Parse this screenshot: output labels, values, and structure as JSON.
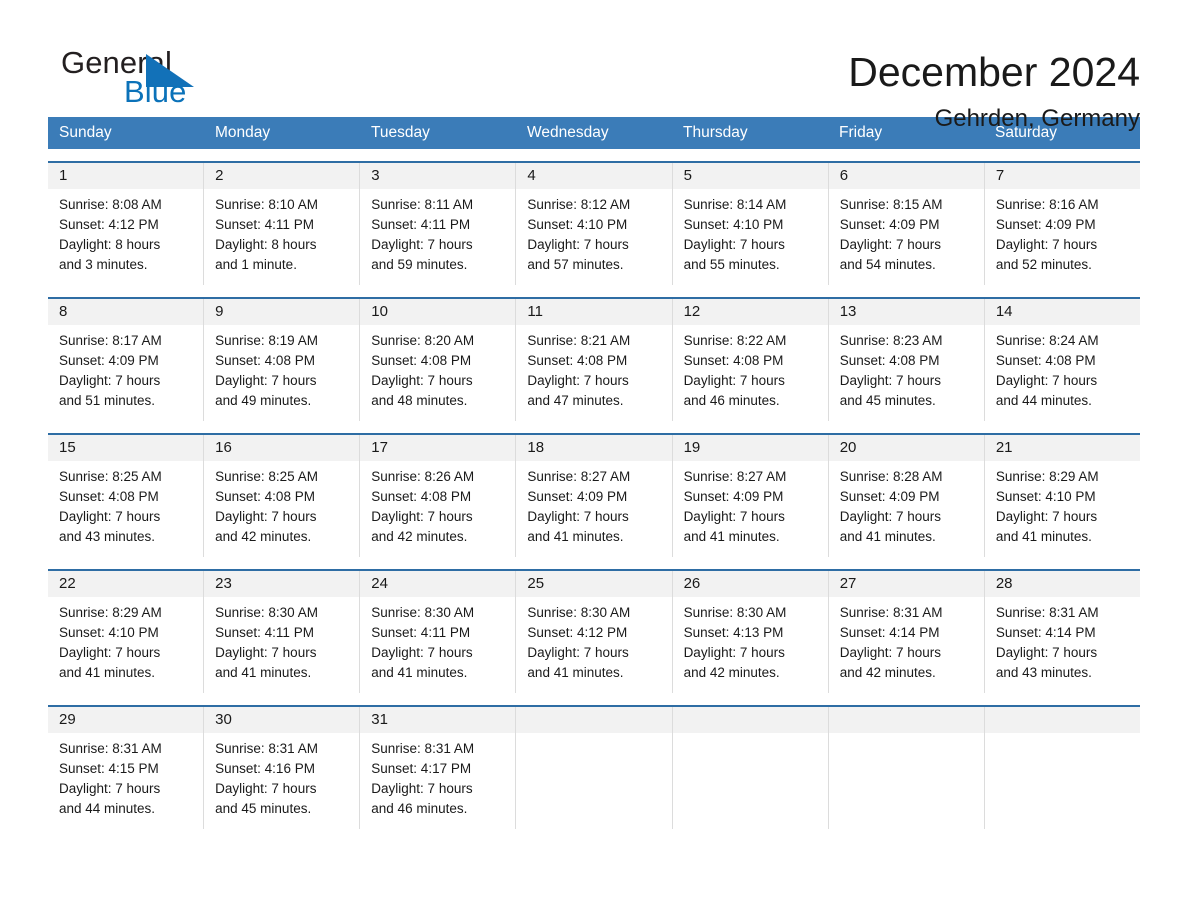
{
  "brand": {
    "name_part1": "General",
    "name_part2": "Blue",
    "logo_icon": "triangle-logo-icon"
  },
  "header": {
    "title": "December 2024",
    "subtitle": "Gehrden, Germany"
  },
  "colors": {
    "header_blue": "#3b7cb8",
    "row_rule_blue": "#2e6da4",
    "brand_blue": "#0b72b9",
    "day_number_bg": "#f2f2f2"
  },
  "weekdays": [
    "Sunday",
    "Monday",
    "Tuesday",
    "Wednesday",
    "Thursday",
    "Friday",
    "Saturday"
  ],
  "weeks": [
    [
      {
        "day": "1",
        "sunrise": "Sunrise: 8:08 AM",
        "sunset": "Sunset: 4:12 PM",
        "daylight_line1": "Daylight: 8 hours",
        "daylight_line2": "and 3 minutes."
      },
      {
        "day": "2",
        "sunrise": "Sunrise: 8:10 AM",
        "sunset": "Sunset: 4:11 PM",
        "daylight_line1": "Daylight: 8 hours",
        "daylight_line2": "and 1 minute."
      },
      {
        "day": "3",
        "sunrise": "Sunrise: 8:11 AM",
        "sunset": "Sunset: 4:11 PM",
        "daylight_line1": "Daylight: 7 hours",
        "daylight_line2": "and 59 minutes."
      },
      {
        "day": "4",
        "sunrise": "Sunrise: 8:12 AM",
        "sunset": "Sunset: 4:10 PM",
        "daylight_line1": "Daylight: 7 hours",
        "daylight_line2": "and 57 minutes."
      },
      {
        "day": "5",
        "sunrise": "Sunrise: 8:14 AM",
        "sunset": "Sunset: 4:10 PM",
        "daylight_line1": "Daylight: 7 hours",
        "daylight_line2": "and 55 minutes."
      },
      {
        "day": "6",
        "sunrise": "Sunrise: 8:15 AM",
        "sunset": "Sunset: 4:09 PM",
        "daylight_line1": "Daylight: 7 hours",
        "daylight_line2": "and 54 minutes."
      },
      {
        "day": "7",
        "sunrise": "Sunrise: 8:16 AM",
        "sunset": "Sunset: 4:09 PM",
        "daylight_line1": "Daylight: 7 hours",
        "daylight_line2": "and 52 minutes."
      }
    ],
    [
      {
        "day": "8",
        "sunrise": "Sunrise: 8:17 AM",
        "sunset": "Sunset: 4:09 PM",
        "daylight_line1": "Daylight: 7 hours",
        "daylight_line2": "and 51 minutes."
      },
      {
        "day": "9",
        "sunrise": "Sunrise: 8:19 AM",
        "sunset": "Sunset: 4:08 PM",
        "daylight_line1": "Daylight: 7 hours",
        "daylight_line2": "and 49 minutes."
      },
      {
        "day": "10",
        "sunrise": "Sunrise: 8:20 AM",
        "sunset": "Sunset: 4:08 PM",
        "daylight_line1": "Daylight: 7 hours",
        "daylight_line2": "and 48 minutes."
      },
      {
        "day": "11",
        "sunrise": "Sunrise: 8:21 AM",
        "sunset": "Sunset: 4:08 PM",
        "daylight_line1": "Daylight: 7 hours",
        "daylight_line2": "and 47 minutes."
      },
      {
        "day": "12",
        "sunrise": "Sunrise: 8:22 AM",
        "sunset": "Sunset: 4:08 PM",
        "daylight_line1": "Daylight: 7 hours",
        "daylight_line2": "and 46 minutes."
      },
      {
        "day": "13",
        "sunrise": "Sunrise: 8:23 AM",
        "sunset": "Sunset: 4:08 PM",
        "daylight_line1": "Daylight: 7 hours",
        "daylight_line2": "and 45 minutes."
      },
      {
        "day": "14",
        "sunrise": "Sunrise: 8:24 AM",
        "sunset": "Sunset: 4:08 PM",
        "daylight_line1": "Daylight: 7 hours",
        "daylight_line2": "and 44 minutes."
      }
    ],
    [
      {
        "day": "15",
        "sunrise": "Sunrise: 8:25 AM",
        "sunset": "Sunset: 4:08 PM",
        "daylight_line1": "Daylight: 7 hours",
        "daylight_line2": "and 43 minutes."
      },
      {
        "day": "16",
        "sunrise": "Sunrise: 8:25 AM",
        "sunset": "Sunset: 4:08 PM",
        "daylight_line1": "Daylight: 7 hours",
        "daylight_line2": "and 42 minutes."
      },
      {
        "day": "17",
        "sunrise": "Sunrise: 8:26 AM",
        "sunset": "Sunset: 4:08 PM",
        "daylight_line1": "Daylight: 7 hours",
        "daylight_line2": "and 42 minutes."
      },
      {
        "day": "18",
        "sunrise": "Sunrise: 8:27 AM",
        "sunset": "Sunset: 4:09 PM",
        "daylight_line1": "Daylight: 7 hours",
        "daylight_line2": "and 41 minutes."
      },
      {
        "day": "19",
        "sunrise": "Sunrise: 8:27 AM",
        "sunset": "Sunset: 4:09 PM",
        "daylight_line1": "Daylight: 7 hours",
        "daylight_line2": "and 41 minutes."
      },
      {
        "day": "20",
        "sunrise": "Sunrise: 8:28 AM",
        "sunset": "Sunset: 4:09 PM",
        "daylight_line1": "Daylight: 7 hours",
        "daylight_line2": "and 41 minutes."
      },
      {
        "day": "21",
        "sunrise": "Sunrise: 8:29 AM",
        "sunset": "Sunset: 4:10 PM",
        "daylight_line1": "Daylight: 7 hours",
        "daylight_line2": "and 41 minutes."
      }
    ],
    [
      {
        "day": "22",
        "sunrise": "Sunrise: 8:29 AM",
        "sunset": "Sunset: 4:10 PM",
        "daylight_line1": "Daylight: 7 hours",
        "daylight_line2": "and 41 minutes."
      },
      {
        "day": "23",
        "sunrise": "Sunrise: 8:30 AM",
        "sunset": "Sunset: 4:11 PM",
        "daylight_line1": "Daylight: 7 hours",
        "daylight_line2": "and 41 minutes."
      },
      {
        "day": "24",
        "sunrise": "Sunrise: 8:30 AM",
        "sunset": "Sunset: 4:11 PM",
        "daylight_line1": "Daylight: 7 hours",
        "daylight_line2": "and 41 minutes."
      },
      {
        "day": "25",
        "sunrise": "Sunrise: 8:30 AM",
        "sunset": "Sunset: 4:12 PM",
        "daylight_line1": "Daylight: 7 hours",
        "daylight_line2": "and 41 minutes."
      },
      {
        "day": "26",
        "sunrise": "Sunrise: 8:30 AM",
        "sunset": "Sunset: 4:13 PM",
        "daylight_line1": "Daylight: 7 hours",
        "daylight_line2": "and 42 minutes."
      },
      {
        "day": "27",
        "sunrise": "Sunrise: 8:31 AM",
        "sunset": "Sunset: 4:14 PM",
        "daylight_line1": "Daylight: 7 hours",
        "daylight_line2": "and 42 minutes."
      },
      {
        "day": "28",
        "sunrise": "Sunrise: 8:31 AM",
        "sunset": "Sunset: 4:14 PM",
        "daylight_line1": "Daylight: 7 hours",
        "daylight_line2": "and 43 minutes."
      }
    ],
    [
      {
        "day": "29",
        "sunrise": "Sunrise: 8:31 AM",
        "sunset": "Sunset: 4:15 PM",
        "daylight_line1": "Daylight: 7 hours",
        "daylight_line2": "and 44 minutes."
      },
      {
        "day": "30",
        "sunrise": "Sunrise: 8:31 AM",
        "sunset": "Sunset: 4:16 PM",
        "daylight_line1": "Daylight: 7 hours",
        "daylight_line2": "and 45 minutes."
      },
      {
        "day": "31",
        "sunrise": "Sunrise: 8:31 AM",
        "sunset": "Sunset: 4:17 PM",
        "daylight_line1": "Daylight: 7 hours",
        "daylight_line2": "and 46 minutes."
      },
      {
        "day": "",
        "sunrise": "",
        "sunset": "",
        "daylight_line1": "",
        "daylight_line2": ""
      },
      {
        "day": "",
        "sunrise": "",
        "sunset": "",
        "daylight_line1": "",
        "daylight_line2": ""
      },
      {
        "day": "",
        "sunrise": "",
        "sunset": "",
        "daylight_line1": "",
        "daylight_line2": ""
      },
      {
        "day": "",
        "sunrise": "",
        "sunset": "",
        "daylight_line1": "",
        "daylight_line2": ""
      }
    ]
  ]
}
